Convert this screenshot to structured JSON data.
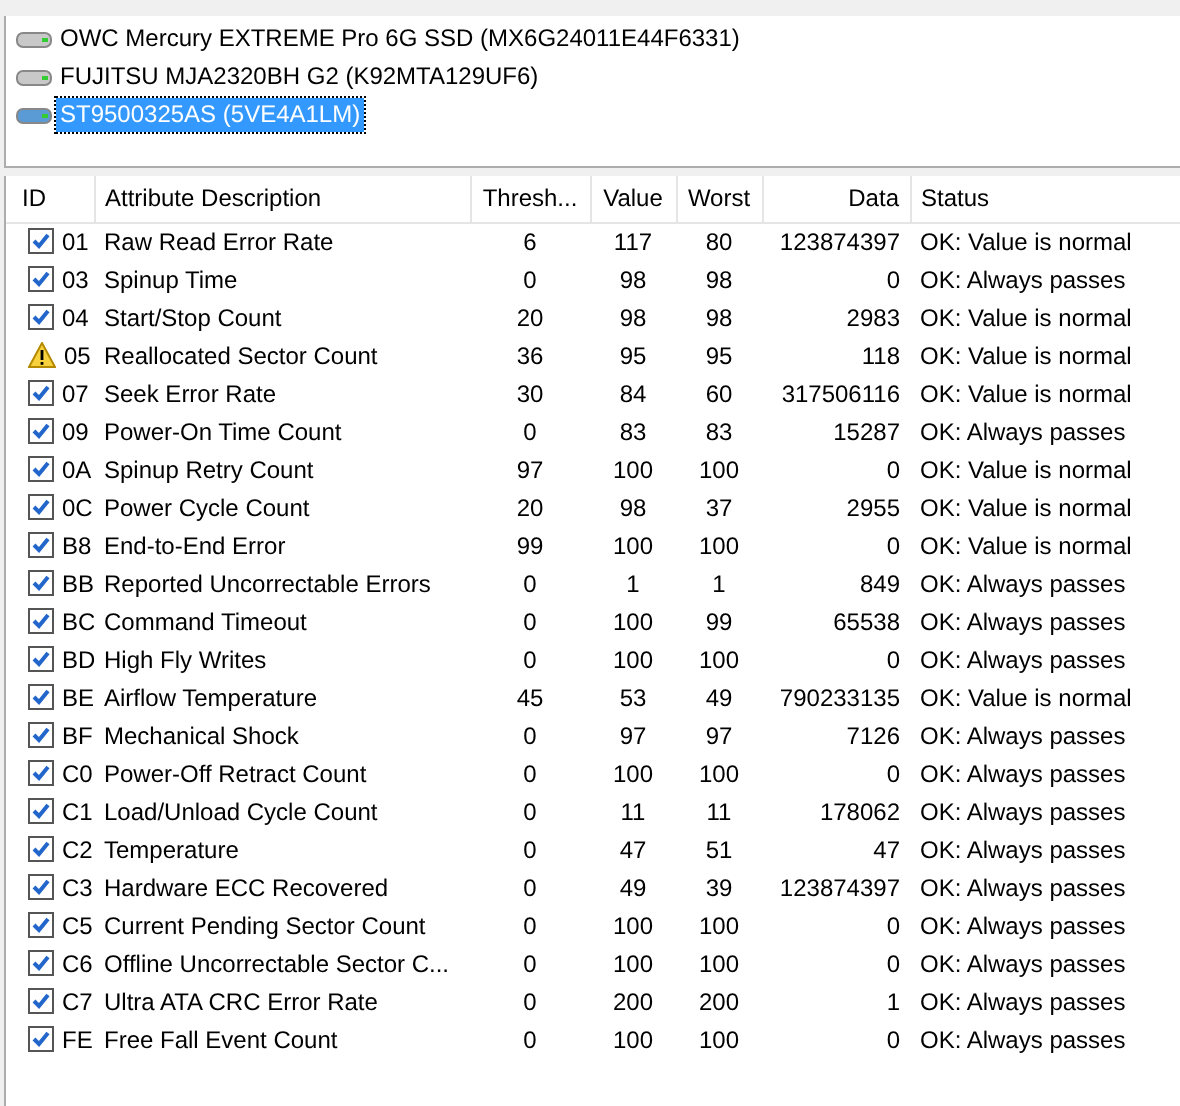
{
  "devices": [
    {
      "label": "OWC Mercury EXTREME Pro 6G SSD (MX6G24011E44F6331)",
      "selected": false
    },
    {
      "label": "FUJITSU MJA2320BH G2 (K92MTA129UF6)",
      "selected": false
    },
    {
      "label": "ST9500325AS (5VE4A1LM)",
      "selected": true
    }
  ],
  "table": {
    "columns": [
      "ID",
      "Attribute Description",
      "Thresh...",
      "Value",
      "Worst",
      "Data",
      "Status"
    ],
    "rows": [
      {
        "kind": "ok",
        "cells": [
          "01",
          "Raw Read Error Rate",
          "6",
          "117",
          "80",
          "123874397",
          "OK: Value is normal"
        ]
      },
      {
        "kind": "ok",
        "cells": [
          "03",
          "Spinup Time",
          "0",
          "98",
          "98",
          "0",
          "OK: Always passes"
        ]
      },
      {
        "kind": "ok",
        "cells": [
          "04",
          "Start/Stop Count",
          "20",
          "98",
          "98",
          "2983",
          "OK: Value is normal"
        ]
      },
      {
        "kind": "warning",
        "cells": [
          "05",
          "Reallocated Sector Count",
          "36",
          "95",
          "95",
          "118",
          "OK: Value is normal"
        ]
      },
      {
        "kind": "ok",
        "cells": [
          "07",
          "Seek Error Rate",
          "30",
          "84",
          "60",
          "317506116",
          "OK: Value is normal"
        ]
      },
      {
        "kind": "ok",
        "cells": [
          "09",
          "Power-On Time Count",
          "0",
          "83",
          "83",
          "15287",
          "OK: Always passes"
        ]
      },
      {
        "kind": "ok",
        "cells": [
          "0A",
          "Spinup Retry Count",
          "97",
          "100",
          "100",
          "0",
          "OK: Value is normal"
        ]
      },
      {
        "kind": "ok",
        "cells": [
          "0C",
          "Power Cycle Count",
          "20",
          "98",
          "37",
          "2955",
          "OK: Value is normal"
        ]
      },
      {
        "kind": "ok",
        "cells": [
          "B8",
          "End-to-End Error",
          "99",
          "100",
          "100",
          "0",
          "OK: Value is normal"
        ]
      },
      {
        "kind": "ok",
        "cells": [
          "BB",
          "Reported Uncorrectable Errors",
          "0",
          "1",
          "1",
          "849",
          "OK: Always passes"
        ]
      },
      {
        "kind": "ok",
        "cells": [
          "BC",
          "Command Timeout",
          "0",
          "100",
          "99",
          "65538",
          "OK: Always passes"
        ]
      },
      {
        "kind": "ok",
        "cells": [
          "BD",
          "High Fly Writes",
          "0",
          "100",
          "100",
          "0",
          "OK: Always passes"
        ]
      },
      {
        "kind": "ok",
        "cells": [
          "BE",
          "Airflow Temperature",
          "45",
          "53",
          "49",
          "790233135",
          "OK: Value is normal"
        ]
      },
      {
        "kind": "ok",
        "cells": [
          "BF",
          "Mechanical Shock",
          "0",
          "97",
          "97",
          "7126",
          "OK: Always passes"
        ]
      },
      {
        "kind": "ok",
        "cells": [
          "C0",
          "Power-Off Retract Count",
          "0",
          "100",
          "100",
          "0",
          "OK: Always passes"
        ]
      },
      {
        "kind": "ok",
        "cells": [
          "C1",
          "Load/Unload Cycle Count",
          "0",
          "11",
          "11",
          "178062",
          "OK: Always passes"
        ]
      },
      {
        "kind": "ok",
        "cells": [
          "C2",
          "Temperature",
          "0",
          "47",
          "51",
          "47",
          "OK: Always passes"
        ]
      },
      {
        "kind": "ok",
        "cells": [
          "C3",
          "Hardware ECC Recovered",
          "0",
          "49",
          "39",
          "123874397",
          "OK: Always passes"
        ]
      },
      {
        "kind": "ok",
        "cells": [
          "C5",
          "Current Pending Sector Count",
          "0",
          "100",
          "100",
          "0",
          "OK: Always passes"
        ]
      },
      {
        "kind": "ok",
        "cells": [
          "C6",
          "Offline Uncorrectable Sector C...",
          "0",
          "100",
          "100",
          "0",
          "OK: Always passes"
        ]
      },
      {
        "kind": "ok",
        "cells": [
          "C7",
          "Ultra ATA CRC Error Rate",
          "0",
          "200",
          "200",
          "1",
          "OK: Always passes"
        ]
      },
      {
        "kind": "ok",
        "cells": [
          "FE",
          "Free Fall Event Count",
          "0",
          "100",
          "100",
          "0",
          "OK: Always passes"
        ]
      }
    ]
  }
}
